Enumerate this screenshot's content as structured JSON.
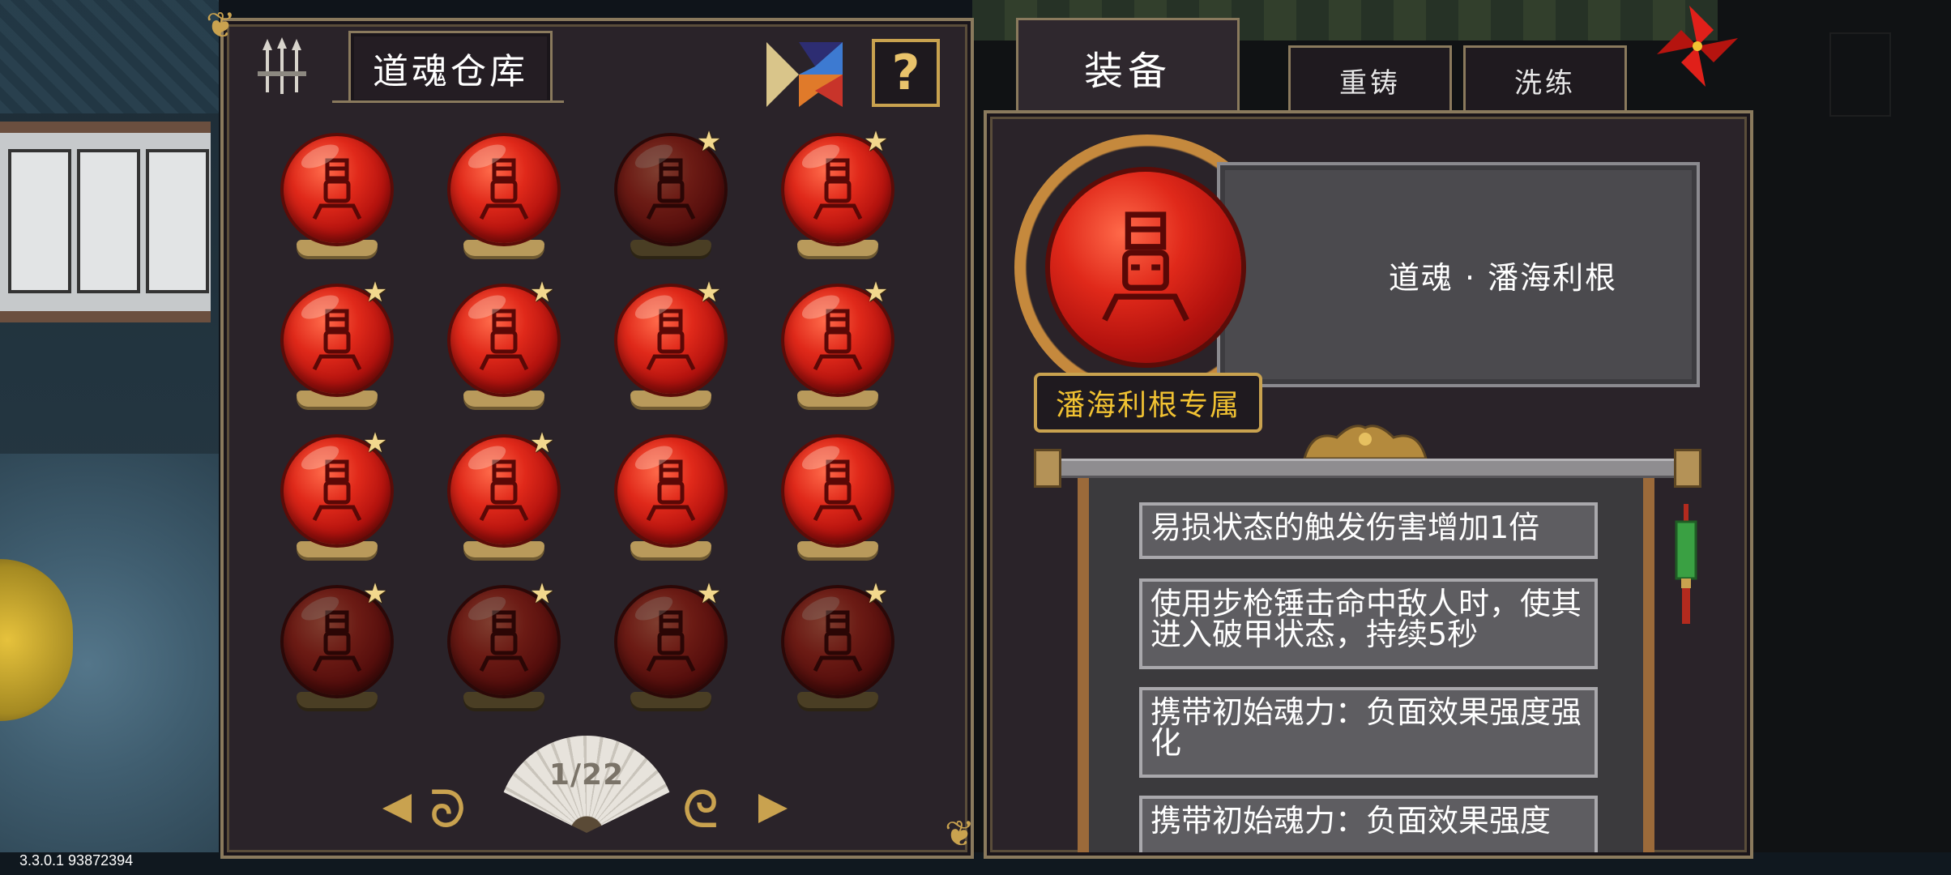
{
  "warehouse": {
    "title": "道魂仓库",
    "pager": {
      "current_page": 1,
      "total_pages": 22,
      "label": "1/22"
    },
    "orbs": [
      {
        "starred": false,
        "dim": false
      },
      {
        "starred": false,
        "dim": false
      },
      {
        "starred": true,
        "dim": true
      },
      {
        "starred": true,
        "dim": false
      },
      {
        "starred": true,
        "dim": false
      },
      {
        "starred": true,
        "dim": false
      },
      {
        "starred": true,
        "dim": false
      },
      {
        "starred": true,
        "dim": false
      },
      {
        "starred": true,
        "dim": false
      },
      {
        "starred": true,
        "dim": false
      },
      {
        "starred": false,
        "dim": false
      },
      {
        "starred": false,
        "dim": false
      },
      {
        "starred": true,
        "dim": true
      },
      {
        "starred": true,
        "dim": true
      },
      {
        "starred": true,
        "dim": true
      },
      {
        "starred": true,
        "dim": true
      }
    ]
  },
  "tabs": {
    "equip": "装备",
    "reforge": "重铸",
    "refine": "洗练"
  },
  "detail": {
    "soul_name": "道魂 · 潘海利根",
    "exclusive_badge": "潘海利根专属",
    "effects": [
      "易损状态的触发伤害增加1倍",
      "使用步枪锤击命中敌人时，使其进入破甲状态，持续5秒",
      "携带初始魂力：负面效果强度强化",
      "携带初始魂力：负面效果强度"
    ]
  },
  "footer": {
    "version": "3.3.0.1 93872394"
  },
  "colors": {
    "accent_gold": "#c9a24f",
    "orb_red": "#e0291a",
    "badge_yellow": "#f1c232",
    "panel_bg": "#2a2329"
  }
}
